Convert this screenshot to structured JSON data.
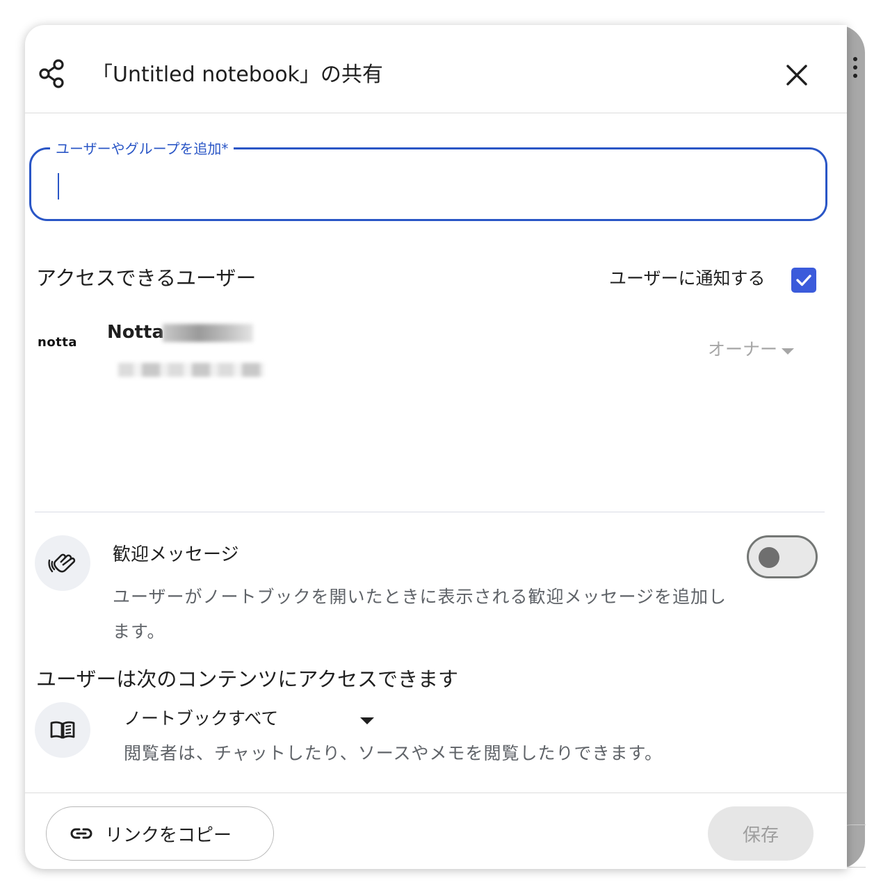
{
  "dialog": {
    "title": "「Untitled notebook」の共有",
    "share_icon": "share-icon",
    "close_icon": "close-icon"
  },
  "add_field": {
    "label": "ユーザーやグループを追加*",
    "value": ""
  },
  "access": {
    "heading": "アクセスできるユーザー",
    "notify_label": "ユーザーに通知する",
    "notify_checked": true,
    "members": [
      {
        "avatar_text": "notta",
        "name": "Notta",
        "role": "オーナー"
      }
    ]
  },
  "welcome": {
    "icon": "waving-hand-icon",
    "title": "歓迎メッセージ",
    "description": "ユーザーがノートブックを開いたときに表示される歓迎メッセージを追加します。",
    "toggle_on": false
  },
  "content_access": {
    "heading": "ユーザーは次のコンテンツにアクセスできます",
    "icon": "book-icon",
    "selected_option": "ノートブックすべて",
    "description": "閲覧者は、チャットしたり、ソースやメモを閲覧したりできます。"
  },
  "footer": {
    "copy_link_label": "リンクをコピー",
    "save_label": "保存"
  },
  "colors": {
    "accent": "#2a56c6",
    "checkbox": "#3b5bdb",
    "muted_text": "#5f6368",
    "disabled": "#9e9e9e"
  }
}
